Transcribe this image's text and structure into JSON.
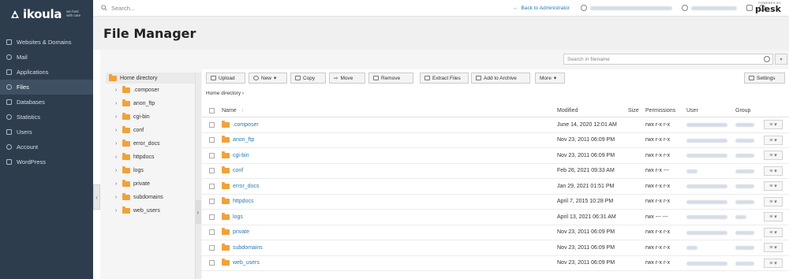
{
  "brand": {
    "name": "ikoula",
    "tagline": "we host with care",
    "color": "#2e3d4e"
  },
  "nav": {
    "items": [
      {
        "label": "Websites & Domains",
        "icon": "globe-icon"
      },
      {
        "label": "Mail",
        "icon": "mail-icon"
      },
      {
        "label": "Applications",
        "icon": "apps-icon"
      },
      {
        "label": "Files",
        "icon": "files-icon",
        "active": true
      },
      {
        "label": "Databases",
        "icon": "database-icon"
      },
      {
        "label": "Statistics",
        "icon": "statistics-icon"
      },
      {
        "label": "Users",
        "icon": "users-icon"
      },
      {
        "label": "Account",
        "icon": "account-icon"
      },
      {
        "label": "WordPress",
        "icon": "wordpress-icon"
      }
    ]
  },
  "topbar": {
    "search_placeholder": "Search...",
    "back_link": "Back to Administrator",
    "powered_by": "POWERED BY",
    "product": "plesk"
  },
  "page": {
    "title": "File Manager"
  },
  "file_search": {
    "placeholder": "Search in filename"
  },
  "tree": {
    "root": "Home directory",
    "items": [
      ".composer",
      "anon_ftp",
      "cgi-bin",
      "conf",
      "error_docs",
      "httpdocs",
      "logs",
      "private",
      "subdomains",
      "web_users"
    ]
  },
  "toolbar": {
    "upload": "Upload",
    "new": "New",
    "copy": "Copy",
    "move": "Move",
    "remove": "Remove",
    "extract": "Extract Files",
    "archive": "Add to Archive",
    "more": "More",
    "settings": "Settings"
  },
  "breadcrumb": "Home directory",
  "table": {
    "headers": {
      "name": "Name",
      "modified": "Modified",
      "size": "Size",
      "permissions": "Permissions",
      "user": "User",
      "group": "Group"
    },
    "rows": [
      {
        "name": ".composer",
        "modified": "June 14, 2020 12:01 AM",
        "perm": "rwx r-x r-x"
      },
      {
        "name": "anon_ftp",
        "modified": "Nov 23, 2011 06:09 PM",
        "perm": "rwx r-x r-x"
      },
      {
        "name": "cgi-bin",
        "modified": "Nov 23, 2011 06:09 PM",
        "perm": "rwx r-x r-x"
      },
      {
        "name": "conf",
        "modified": "Feb 26, 2021 09:33 AM",
        "perm": "rwx r-x ---"
      },
      {
        "name": "error_docs",
        "modified": "Jan 29, 2021 01:51 PM",
        "perm": "rwx r-x r-x"
      },
      {
        "name": "httpdocs",
        "modified": "April 7, 2015 10:28 PM",
        "perm": "rwx r-x r-x"
      },
      {
        "name": "logs",
        "modified": "April 13, 2021 06:31 AM",
        "perm": "rwx --- ---"
      },
      {
        "name": "private",
        "modified": "Nov 23, 2011 06:09 PM",
        "perm": "rwx r-x r-x"
      },
      {
        "name": "subdomains",
        "modified": "Nov 23, 2011 06:09 PM",
        "perm": "rwx r-x r-x"
      },
      {
        "name": "web_users",
        "modified": "Nov 23, 2011 06:09 PM",
        "perm": "rwx r-x r-x"
      }
    ]
  },
  "colors": {
    "link": "#2a7ab0",
    "folder": "#f0a23a",
    "sidebar": "#2e3d4e"
  }
}
